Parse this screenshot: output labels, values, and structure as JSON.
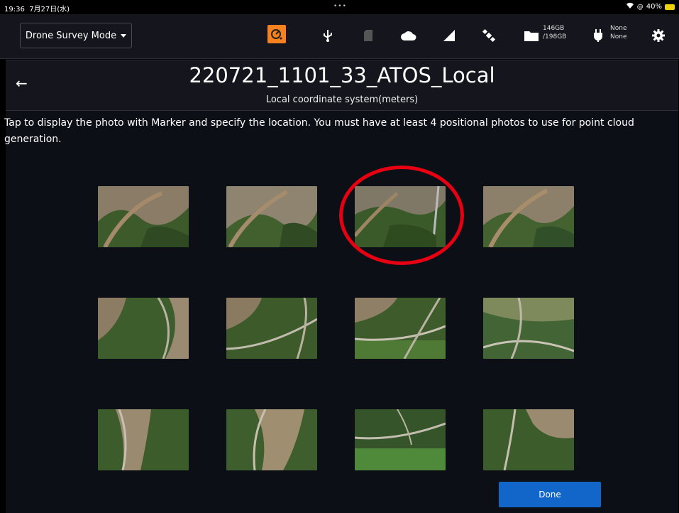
{
  "status_bar": {
    "time": "19:36",
    "date": "7月27日(水)",
    "battery": "40%"
  },
  "toolbar": {
    "mode_label": "Drone Survey Mode",
    "storage_used": "146GB",
    "storage_total": "/198GB",
    "power_line1": "None",
    "power_line2": "None",
    "icons": [
      "app-icon",
      "usb-icon",
      "sd-card-icon",
      "cloud-icon",
      "signal-icon",
      "satellite-icon",
      "folder-icon",
      "plug-icon",
      "gear-icon"
    ],
    "accent_color": "#f5821f"
  },
  "header": {
    "title": "220721_1101_33_ATOS_Local",
    "subtitle": "Local coordinate system(meters)"
  },
  "instructions": "Tap to display the photo with Marker and specify the location. You must have at least 4 positional photos to use for point cloud generation.",
  "photos": [
    {
      "variant": "a"
    },
    {
      "variant": "b"
    },
    {
      "variant": "c"
    },
    {
      "variant": "d"
    },
    {
      "variant": "e"
    },
    {
      "variant": "f"
    },
    {
      "variant": "g"
    },
    {
      "variant": "h"
    },
    {
      "variant": "i"
    },
    {
      "variant": "j"
    },
    {
      "variant": "k"
    },
    {
      "variant": "l"
    }
  ],
  "highlighted_photo_index": 2,
  "done_label": "Done",
  "colors": {
    "done_button": "#1366c9",
    "highlight": "#e60012"
  }
}
